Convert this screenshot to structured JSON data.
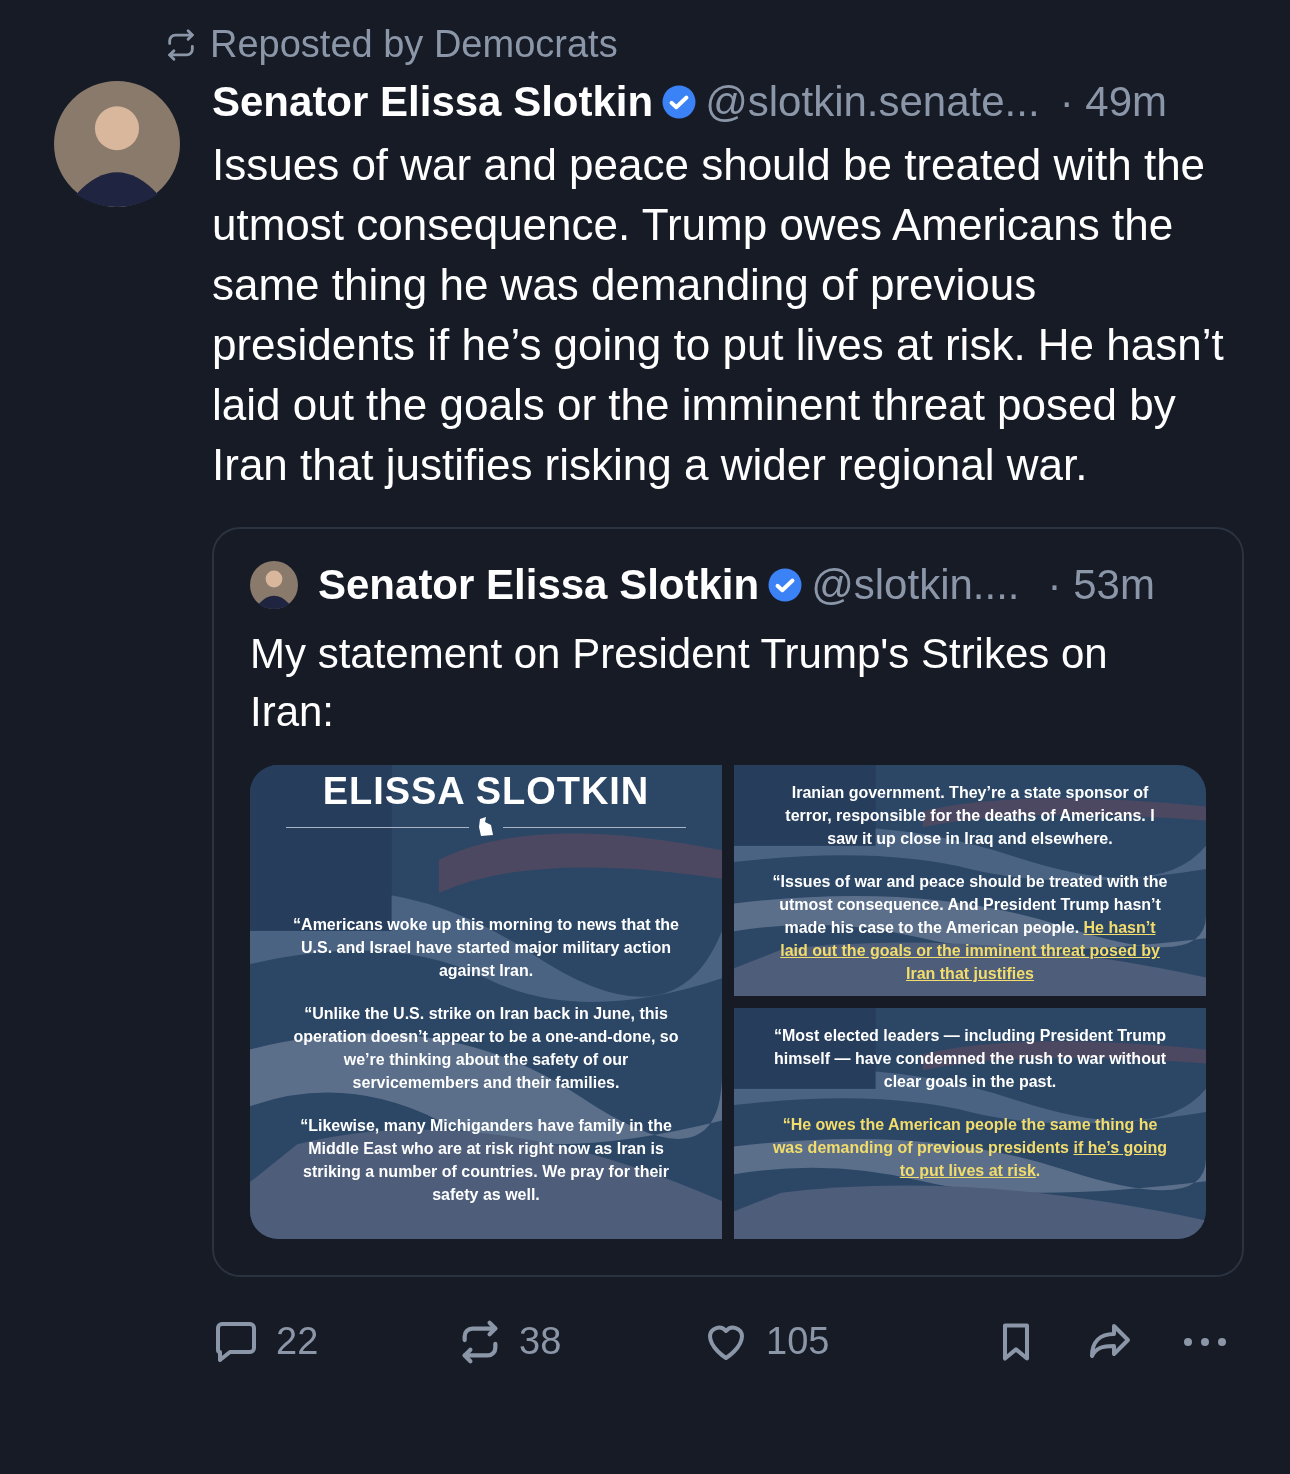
{
  "repost": {
    "label": "Reposted by Democrats"
  },
  "post": {
    "author": "Senator Elissa Slotkin",
    "verified": true,
    "handle": "@slotkin.senate...",
    "time": "· 49m",
    "text": "Issues of war and peace should be treated with the utmost consequence. Trump owes Americans the same thing he was demanding of previous presidents if he’s going to put lives at risk. He hasn’t laid out the goals or the imminent threat posed by Iran that justifies risking a wider regional war."
  },
  "quote": {
    "author": "Senator Elissa Slotkin",
    "verified": true,
    "handle": "@slotkin....",
    "time": "· 53m",
    "text": "My statement on President Trump's Strikes on Iran:",
    "images": [
      {
        "heading": "ELISSA SLOTKIN",
        "paragraphs": [
          [
            {
              "text": "“Americans woke up this morning to news that the U.S. and Israel have started major military action against Iran.",
              "highlighted": false,
              "underlined": false
            }
          ],
          [
            {
              "text": "“Unlike the U.S. strike on Iran back in June, this operation doesn’t appear to be a one-and-done, so we’re thinking about the safety of our servicemembers and their families.",
              "highlighted": false,
              "underlined": false
            }
          ],
          [
            {
              "text": "“Likewise, many Michiganders have family in the Middle East who are at risk right now as Iran is striking a number of countries. We pray for their safety as well.",
              "highlighted": false,
              "underlined": false
            }
          ]
        ]
      },
      {
        "paragraphs": [
          [
            {
              "text": "Iranian government. They’re a state sponsor of terror, responsible for the deaths of Americans. I saw it up close in Iraq and elsewhere.",
              "highlighted": false,
              "underlined": false
            }
          ],
          [
            {
              "text": "“Issues of war and peace should be treated with the utmost consequence. And President Trump hasn’t made his case to the American people. ",
              "highlighted": false,
              "underlined": false
            },
            {
              "text": "He hasn’t laid out the goals or the imminent threat posed by Iran that justifies",
              "highlighted": true,
              "underlined": true
            }
          ]
        ]
      },
      {
        "paragraphs": [
          [
            {
              "text": "“Most elected leaders — including President Trump himself — have condemned the rush to war without clear goals in the past.",
              "highlighted": false,
              "underlined": false
            }
          ],
          [
            {
              "text": "“He owes the American people the same thing he was demanding of previous presidents ",
              "highlighted": true,
              "underlined": false
            },
            {
              "text": "if he’s going to put lives at risk",
              "highlighted": true,
              "underlined": true
            },
            {
              "text": ".",
              "highlighted": true,
              "underlined": false
            }
          ]
        ]
      }
    ]
  },
  "actions": {
    "replies": "22",
    "reposts": "38",
    "likes": "105"
  }
}
